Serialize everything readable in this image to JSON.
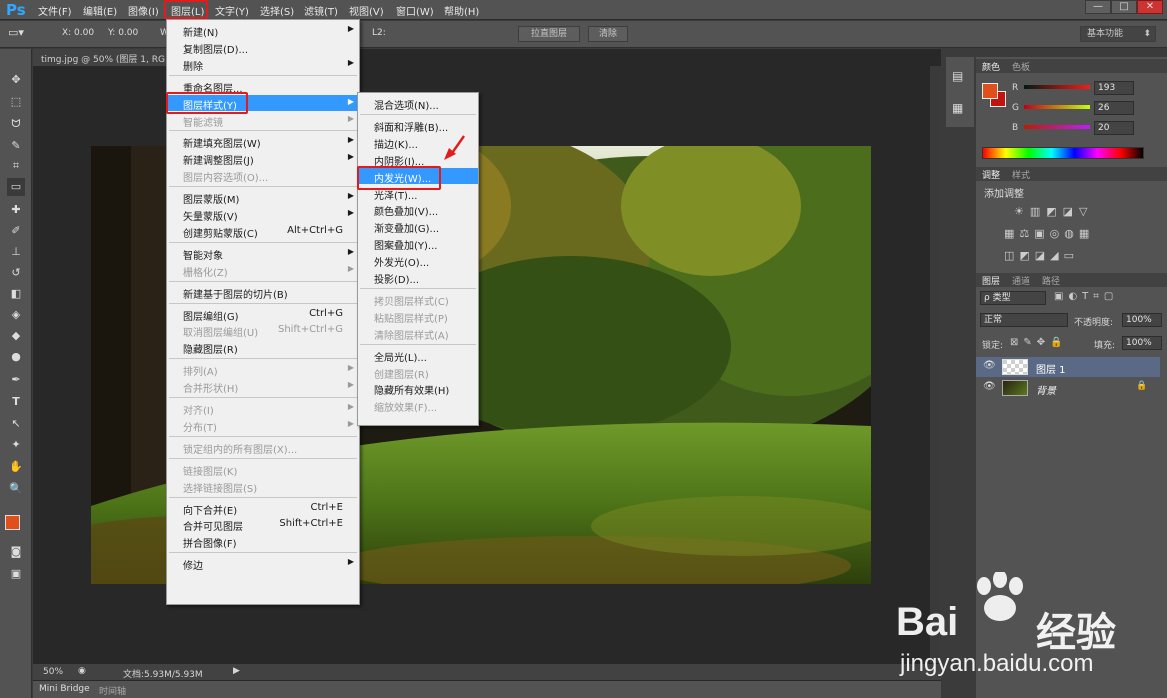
{
  "app": {
    "logo": "Ps"
  },
  "menubar": {
    "items": [
      "文件(F)",
      "编辑(E)",
      "图像(I)",
      "图层(L)",
      "文字(Y)",
      "选择(S)",
      "滤镜(T)",
      "视图(V)",
      "窗口(W)",
      "帮助(H)"
    ],
    "active_index": 3,
    "window_controls": [
      "—",
      "□",
      "✕"
    ]
  },
  "optionsbar": {
    "x_label": "X: 0.00",
    "y_label": "Y: 0.00",
    "w_label": "W",
    "l2_label": "L2:",
    "straighten_button": "拉直图层",
    "clear_button": "清除",
    "workspace": "基本功能"
  },
  "document": {
    "tab_title": "timg.jpg @ 50% (图层 1, RG",
    "zoom": "50%",
    "doc_size": "文档:5.93M/5.93M"
  },
  "bottom_tabs": [
    "Mini Bridge",
    "时间轴"
  ],
  "layer_menu": {
    "items": [
      {
        "label": "新建(N)",
        "submenu": true
      },
      {
        "label": "复制图层(D)..."
      },
      {
        "label": "删除",
        "submenu": true
      },
      {
        "sep": true
      },
      {
        "label": "重命名图层..."
      },
      {
        "label": "图层样式(Y)",
        "submenu": true,
        "highlight": true
      },
      {
        "label": "智能滤镜",
        "submenu": true,
        "disabled": true
      },
      {
        "sep": true
      },
      {
        "label": "新建填充图层(W)",
        "submenu": true
      },
      {
        "label": "新建调整图层(J)",
        "submenu": true
      },
      {
        "label": "图层内容选项(O)...",
        "disabled": true
      },
      {
        "sep": true
      },
      {
        "label": "图层蒙版(M)",
        "submenu": true
      },
      {
        "label": "矢量蒙版(V)",
        "submenu": true
      },
      {
        "label": "创建剪贴蒙版(C)",
        "shortcut": "Alt+Ctrl+G"
      },
      {
        "sep": true
      },
      {
        "label": "智能对象",
        "submenu": true
      },
      {
        "label": "栅格化(Z)",
        "submenu": true,
        "disabled": true
      },
      {
        "sep": true
      },
      {
        "label": "新建基于图层的切片(B)"
      },
      {
        "sep": true
      },
      {
        "label": "图层编组(G)",
        "shortcut": "Ctrl+G"
      },
      {
        "label": "取消图层编组(U)",
        "shortcut": "Shift+Ctrl+G",
        "disabled": true
      },
      {
        "label": "隐藏图层(R)"
      },
      {
        "sep": true
      },
      {
        "label": "排列(A)",
        "submenu": true,
        "disabled": true
      },
      {
        "label": "合并形状(H)",
        "submenu": true,
        "disabled": true
      },
      {
        "sep": true
      },
      {
        "label": "对齐(I)",
        "submenu": true,
        "disabled": true
      },
      {
        "label": "分布(T)",
        "submenu": true,
        "disabled": true
      },
      {
        "sep": true
      },
      {
        "label": "锁定组内的所有图层(X)...",
        "disabled": true
      },
      {
        "sep": true
      },
      {
        "label": "链接图层(K)",
        "disabled": true
      },
      {
        "label": "选择链接图层(S)",
        "disabled": true
      },
      {
        "sep": true
      },
      {
        "label": "向下合并(E)",
        "shortcut": "Ctrl+E"
      },
      {
        "label": "合并可见图层",
        "shortcut": "Shift+Ctrl+E"
      },
      {
        "label": "拼合图像(F)"
      },
      {
        "sep": true
      },
      {
        "label": "修边",
        "submenu": true
      }
    ]
  },
  "style_menu": {
    "items": [
      {
        "label": "混合选项(N)..."
      },
      {
        "sep": true
      },
      {
        "label": "斜面和浮雕(B)..."
      },
      {
        "label": "描边(K)..."
      },
      {
        "label": "内阴影(I)..."
      },
      {
        "label": "内发光(W)...",
        "highlight": true
      },
      {
        "label": "光泽(T)..."
      },
      {
        "label": "颜色叠加(V)..."
      },
      {
        "label": "渐变叠加(G)..."
      },
      {
        "label": "图案叠加(Y)..."
      },
      {
        "label": "外发光(O)..."
      },
      {
        "label": "投影(D)..."
      },
      {
        "sep": true
      },
      {
        "label": "拷贝图层样式(C)",
        "disabled": true
      },
      {
        "label": "粘贴图层样式(P)",
        "disabled": true
      },
      {
        "label": "清除图层样式(A)",
        "disabled": true
      },
      {
        "sep": true
      },
      {
        "label": "全局光(L)..."
      },
      {
        "label": "创建图层(R)",
        "disabled": true
      },
      {
        "label": "隐藏所有效果(H)"
      },
      {
        "label": "缩放效果(F)...",
        "disabled": true
      }
    ]
  },
  "color_panel": {
    "tabs": [
      "颜色",
      "色板"
    ],
    "channels": [
      {
        "label": "R",
        "value": "193"
      },
      {
        "label": "G",
        "value": "26"
      },
      {
        "label": "B",
        "value": "20"
      }
    ],
    "foreground": "#e0501a",
    "background": "#c1140e"
  },
  "adjust_panel": {
    "tabs": [
      "调整",
      "样式"
    ],
    "title": "添加调整"
  },
  "layers_panel": {
    "tabs": [
      "图层",
      "通道",
      "路径"
    ],
    "filter": "ρ 类型",
    "blend_mode": "正常",
    "opacity_label": "不透明度:",
    "opacity": "100%",
    "lock_label": "锁定:",
    "fill_label": "填充:",
    "fill": "100%",
    "layers": [
      {
        "name": "图层 1",
        "selected": true
      },
      {
        "name": "背景",
        "italic": true
      }
    ]
  },
  "watermark": {
    "brand_left": "Bai",
    "brand_right": "经验",
    "url": "jingyan.baidu.com"
  }
}
